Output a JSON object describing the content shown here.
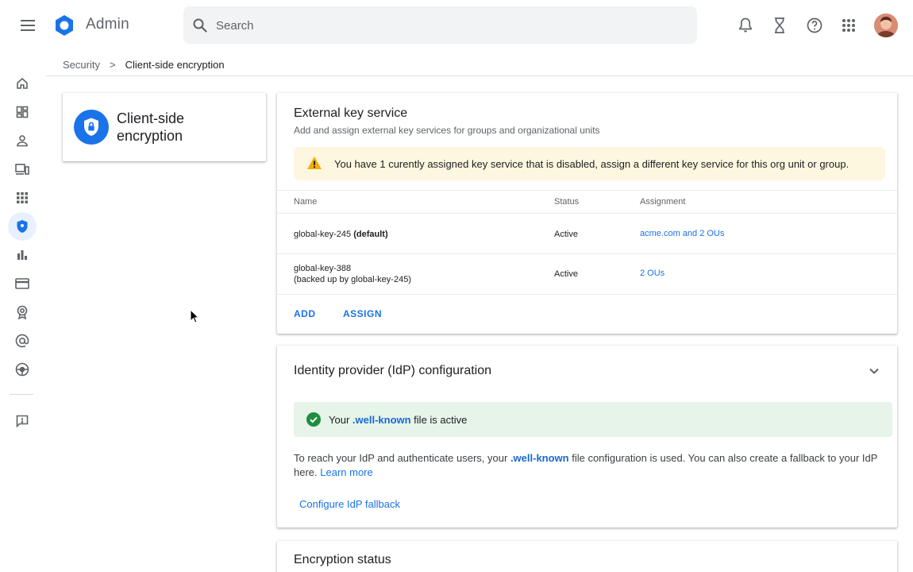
{
  "header": {
    "app_name": "Admin",
    "search_placeholder": "Search"
  },
  "breadcrumb": {
    "parent": "Security",
    "separator": ">",
    "current": "Client-side encryption"
  },
  "product": {
    "title": "Client-side encryption"
  },
  "key_service": {
    "title": "External key service",
    "subtitle": "Add and assign external key services for groups and organizational units",
    "warning": "You have 1 curently assigned key service that is disabled, assign a different key service for this org unit or group.",
    "columns": [
      "Name",
      "Status",
      "Assignment"
    ],
    "rows": [
      {
        "name": "global-key-245",
        "name_suffix": "(default)",
        "name_sub": "",
        "status": "Active",
        "assignment": "acme.com and 2 OUs"
      },
      {
        "name": "global-key-388",
        "name_suffix": "",
        "name_sub": "(backed up by global-key-245)",
        "status": "Active",
        "assignment": "2 OUs"
      }
    ],
    "add_label": "ADD",
    "assign_label": "ASSIGN"
  },
  "idp": {
    "title": "Identity provider (IdP) configuration",
    "status_prefix": "Your ",
    "status_link": ".well-known",
    "status_suffix": " file is active",
    "para_1": "To reach your IdP and authenticate users, your ",
    "para_link": ".well-known",
    "para_2": " file configuration is used. You can also create a fallback to your IdP here. ",
    "learn_more": "Learn more",
    "fallback_link": "Configure IdP fallback"
  },
  "encryption_status": {
    "title": "Encryption status"
  },
  "colors": {
    "accent": "#1a73e8",
    "warning_bg": "#fef7e0",
    "success_bg": "#e6f4ea",
    "warning_icon": "#f9ab00",
    "success_icon": "#1e8e3e"
  },
  "icons": {
    "header": [
      "menu-icon",
      "admin-logo-icon",
      "search-icon",
      "notifications-icon",
      "hourglass-icon",
      "help-icon",
      "apps-grid-icon"
    ],
    "rail": [
      "home-icon",
      "dashboard-icon",
      "users-icon",
      "devices-icon",
      "apps-icon",
      "security-icon",
      "reports-icon",
      "billing-icon",
      "account-icon",
      "domains-icon",
      "support-icon",
      "feedback-icon"
    ]
  }
}
